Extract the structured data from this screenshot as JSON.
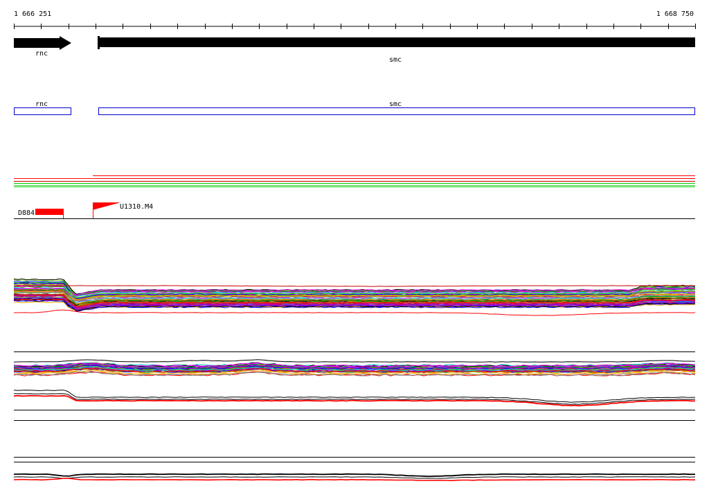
{
  "coordinates": {
    "start_label": "1 666 251",
    "end_label": "1 668 750"
  },
  "genes": [
    {
      "name": "rnc",
      "strand": "+",
      "color": "#000000"
    },
    {
      "name": "smc",
      "strand": "+",
      "color": "#000000"
    }
  ],
  "cds": [
    {
      "name": "rnc",
      "color": "#0000cc"
    },
    {
      "name": "smc",
      "color": "#0000cc"
    }
  ],
  "features": [
    {
      "name": "D884",
      "type": "region",
      "color": "#ff0000"
    },
    {
      "name": "U1310.M4",
      "type": "transcription-start",
      "color": "#ff0000"
    }
  ],
  "colors": {
    "track_line": "#000000",
    "highlight": "#ff0000",
    "guide_lines": [
      "#ff0000",
      "#00cc00",
      "#cc0000",
      "#33cc33"
    ],
    "expression_palette": [
      "#000000",
      "#ff0000",
      "#0000ff",
      "#00aa00",
      "#ff00ff",
      "#00cccc",
      "#ffaa00",
      "#8800ff",
      "#888888",
      "#aa5500",
      "#66cc00",
      "#cc0066"
    ]
  }
}
